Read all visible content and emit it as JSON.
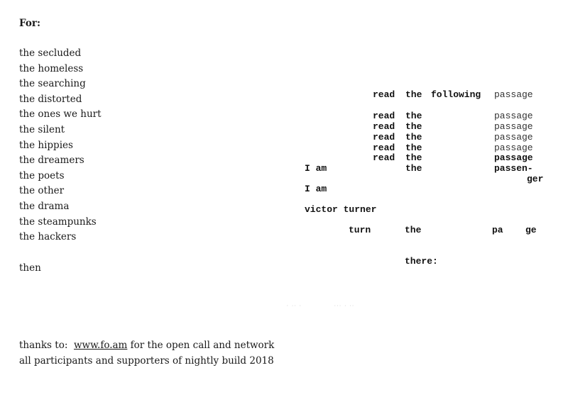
{
  "left_column": {
    "heading": "For:",
    "dedications": [
      "the secluded",
      "the homeless",
      "the searching",
      "the distorted",
      "the ones we hurt",
      "the silent",
      "the hippies",
      "the dreamers",
      "the poets",
      "the other",
      "the drama",
      "the steampunks",
      "the hackers"
    ],
    "closing_word": "then"
  },
  "typewriter_poem": {
    "line1": {
      "a": "read",
      "b": "the",
      "c": "following",
      "d": "passage"
    },
    "repeats": [
      {
        "a": "read",
        "b": "the",
        "d": "passage"
      },
      {
        "a": "read",
        "b": "the",
        "d": "passage"
      },
      {
        "a": "read",
        "b": "the",
        "d": "passage"
      },
      {
        "a": "read",
        "b": "the",
        "d": "passage"
      },
      {
        "a": "read",
        "b": "the",
        "d": "passage"
      }
    ],
    "i_am_line": {
      "a": "I am",
      "b": "the",
      "d": "passen-",
      "d2": "ger"
    },
    "i_am_2": "I am",
    "name_line": "victor turner",
    "turn_line": {
      "a": "turn",
      "b": "the",
      "c": "pa",
      "d": "ge"
    },
    "there": "there:"
  },
  "footer": {
    "thanks_prefix": "thanks to:",
    "link_text": "www.fo.am",
    "thanks_suffix": "for the open call and network",
    "line2": "all participants and supporters of nightly build 2018"
  }
}
